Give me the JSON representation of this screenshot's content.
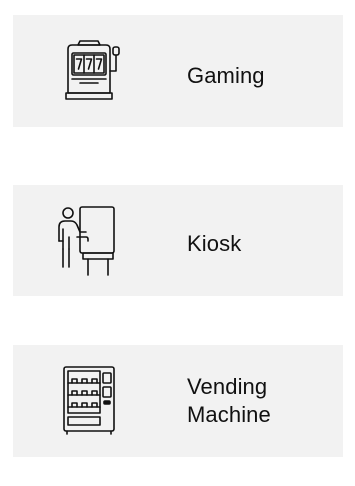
{
  "items": [
    {
      "label": "Gaming",
      "icon": "slot-machine-icon"
    },
    {
      "label": "Kiosk",
      "icon": "kiosk-icon"
    },
    {
      "label": "Vending\nMachine",
      "icon": "vending-machine-icon"
    }
  ],
  "colors": {
    "card_background": "#f2f2f2",
    "text": "#111111",
    "icon_stroke": "#111111"
  }
}
